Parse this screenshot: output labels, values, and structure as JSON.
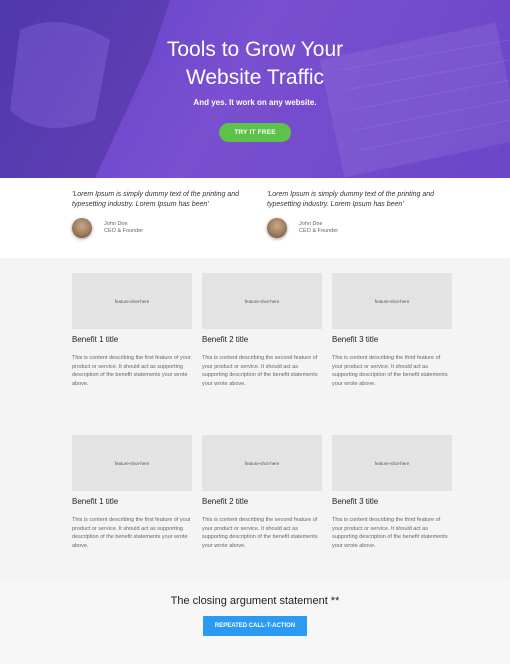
{
  "hero": {
    "title_line1": "Tools to Grow Your",
    "title_line2": "Website Traffic",
    "subtitle": "And yes. It work on any website.",
    "cta_label": "TRY IT FREE"
  },
  "testimonials": [
    {
      "quote": "'Lorem Ipsum is simply dummy text of the printing and typesetting industry. Lorem Ipsum has been'",
      "name": "John Doe",
      "role": "CEO & Founder"
    },
    {
      "quote": "'Lorem Ipsum is simply dummy text of the printing and typesetting industry. Lorem Ipsum has been'",
      "name": "John Doe",
      "role": "CEO & Founder"
    }
  ],
  "features": {
    "rows": [
      [
        {
          "shot_label": "feature-shot-here",
          "title": "Benefit 1 title",
          "desc": "This is content describing the first feature of your product or service. It should act as supporting description of the benefit statements your wrote above."
        },
        {
          "shot_label": "feature-shot-here",
          "title": "Benefit 2 title",
          "desc": "This is content describing the second feature of your product or service. It should act as supporting description of the benefit statements your wrote above."
        },
        {
          "shot_label": "feature-shot-here",
          "title": "Benefit 3 title",
          "desc": "This is content describing the third feature of your product or service. It should act as supporting description of the benefit statements your wrote above."
        }
      ],
      [
        {
          "shot_label": "feature-shot-here",
          "title": "Benefit 1 title",
          "desc": "This is content describing the first feature of your product or service. It should act as supporting description of the benefit statements your wrote above."
        },
        {
          "shot_label": "feature-shot-here",
          "title": "Benefit 2 title",
          "desc": "This is content describing the second feature of your product or service. It should act as supporting description of the benefit statements your wrote above."
        },
        {
          "shot_label": "feature-shot-here",
          "title": "Benefit 3 title",
          "desc": "This is content describing the third feature of your product or service. It should act as supporting description of the benefit statements your wrote above."
        }
      ]
    ]
  },
  "closing": {
    "title": "The closing argument statement **",
    "cta_label": "REPEATED CALL-T-ACTION"
  },
  "colors": {
    "hero_purple": "#6a46c8",
    "cta_green": "#5cc24a",
    "cta_blue": "#2b9af3"
  }
}
